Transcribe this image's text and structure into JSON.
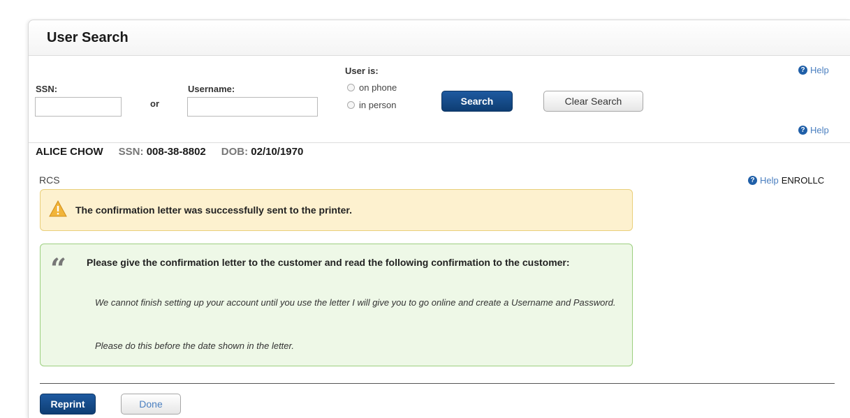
{
  "page": {
    "title": "User Search"
  },
  "search": {
    "ssn_label": "SSN:",
    "ssn_value": "",
    "or_label": "or",
    "username_label": "Username:",
    "username_value": "",
    "user_is_label": "User is:",
    "option_phone": "on phone",
    "option_person": "in person",
    "search_button": "Search",
    "clear_button": "Clear Search",
    "help": "Help"
  },
  "user": {
    "name": "ALICE CHOW",
    "ssn_label": "SSN:",
    "ssn_value": "008-38-8802",
    "dob_label": "DOB:",
    "dob_value": "02/10/1970",
    "help": "Help"
  },
  "section": {
    "label": "RCS",
    "help": "Help",
    "code": "ENROLLC"
  },
  "alerts": {
    "warning": "The confirmation letter was successfully sent to the printer.",
    "info_heading": "Please give the confirmation letter to the customer and read the following confirmation to the customer:",
    "info_body_1": "We cannot finish setting up your account until you use the letter I will give you to go online and create a Username and Password.",
    "info_body_2": "Please do this before the date shown in the letter."
  },
  "actions": {
    "reprint": "Reprint",
    "done": "Done"
  },
  "colors": {
    "primary_button": "#0e3d73",
    "help_link": "#4a7fc0",
    "warning_bg": "#fdf1cf",
    "info_bg": "#eef8e7"
  },
  "icons": {
    "help": "help-icon",
    "warning": "warning-icon",
    "quote": "quote-icon"
  }
}
